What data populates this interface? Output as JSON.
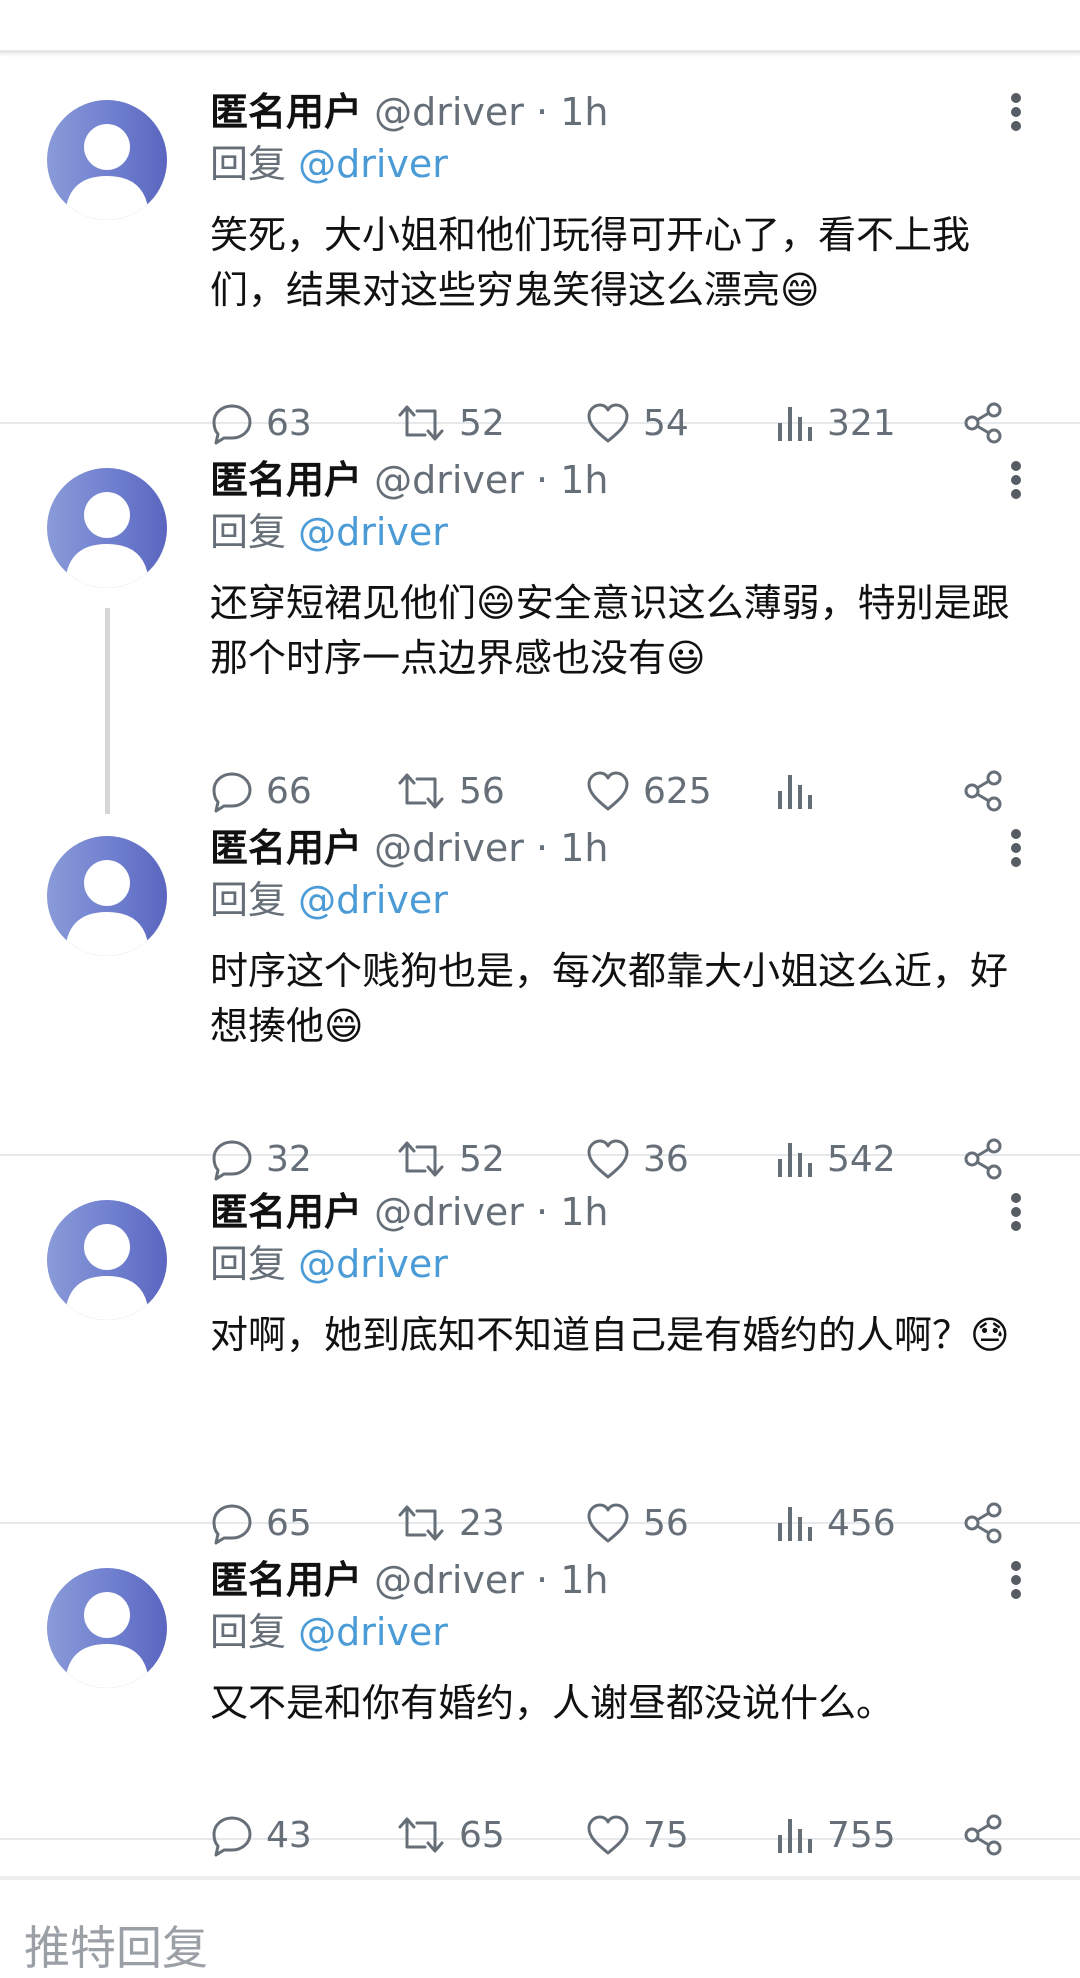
{
  "footer": {
    "label": "推特回复"
  },
  "tweets": [
    {
      "name": "匿名用户",
      "handle": "@driver",
      "dot": "·",
      "time": "1h",
      "reply_prefix": "回复",
      "reply_to": "@driver",
      "text": "笑死，大小姐和他们玩得可开心了，看不上我们，结果对这些穷鬼笑得这么漂亮😄",
      "replies": "63",
      "retweets": "52",
      "likes": "54",
      "views": "321"
    },
    {
      "name": "匿名用户",
      "handle": "@driver",
      "dot": "·",
      "time": "1h",
      "reply_prefix": "回复",
      "reply_to": "@driver",
      "text": "还穿短裙见他们😄安全意识这么薄弱，特别是跟那个时序一点边界感也没有😃",
      "replies": "66",
      "retweets": "56",
      "likes": "625",
      "views": ""
    },
    {
      "name": "匿名用户",
      "handle": "@driver",
      "dot": "·",
      "time": "1h",
      "reply_prefix": "回复",
      "reply_to": "@driver",
      "text": "时序这个贱狗也是，每次都靠大小姐这么近，好想揍他😄",
      "replies": "32",
      "retweets": "52",
      "likes": "36",
      "views": "542"
    },
    {
      "name": "匿名用户",
      "handle": "@driver",
      "dot": "·",
      "time": "1h",
      "reply_prefix": "回复",
      "reply_to": "@driver",
      "text": "对啊，她到底知不知道自己是有婚约的人啊？😓",
      "replies": "65",
      "retweets": "23",
      "likes": "56",
      "views": "456"
    },
    {
      "name": "匿名用户",
      "handle": "@driver",
      "dot": "·",
      "time": "1h",
      "reply_prefix": "回复",
      "reply_to": "@driver",
      "text": "又不是和你有婚约，人谢昼都没说什么。",
      "replies": "43",
      "retweets": "65",
      "likes": "75",
      "views": "755"
    }
  ],
  "icons": {
    "reply": "speech-bubble",
    "retweet": "retweet-arrows",
    "like": "heart",
    "views": "bar-chart",
    "share": "share-nodes",
    "more": "vertical-dots",
    "avatar": "default-person"
  },
  "colors": {
    "link": "#4a9bd6",
    "muted": "#666f78",
    "avatar": "#7383cf"
  }
}
